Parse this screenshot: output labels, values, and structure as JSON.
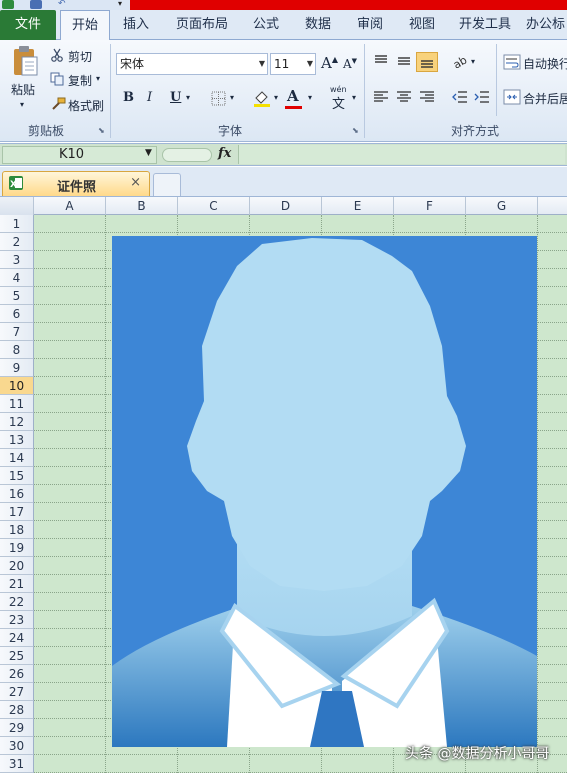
{
  "tabs": {
    "file": "文件",
    "home": "开始",
    "insert": "插入",
    "page_layout": "页面布局",
    "formulas": "公式",
    "data": "数据",
    "review": "审阅",
    "view": "视图",
    "developer": "开发工具",
    "office": "办公标"
  },
  "clipboard": {
    "paste": "粘贴",
    "cut": "剪切",
    "copy": "复制",
    "format_painter": "格式刷",
    "group_label": "剪贴板"
  },
  "font": {
    "name": "宋体",
    "size": "11",
    "bold": "B",
    "italic": "I",
    "underline": "U",
    "font_color_glyph": "A",
    "grow": "A",
    "shrink": "A",
    "phonetic": "wén",
    "phonetic_char": "文",
    "group_label": "字体"
  },
  "alignment": {
    "wrap_text": "自动换行",
    "merge_center": "合并后居",
    "group_label": "对齐方式"
  },
  "formula_bar": {
    "cell_ref": "K10",
    "fx": "fx"
  },
  "document": {
    "tab_title": "证件照",
    "close": "×"
  },
  "grid": {
    "columns": [
      "A",
      "B",
      "C",
      "D",
      "E",
      "F",
      "G"
    ],
    "rows": [
      "1",
      "2",
      "3",
      "4",
      "5",
      "6",
      "7",
      "8",
      "9",
      "10",
      "11",
      "12",
      "13",
      "14",
      "15",
      "16",
      "17",
      "18",
      "19",
      "20",
      "21",
      "22",
      "23",
      "24",
      "25",
      "26",
      "27",
      "28",
      "29",
      "30",
      "31"
    ],
    "selected_row": "10"
  },
  "colors": {
    "sheet_bg": "#cee7cd",
    "photo_bg": "#3d86d6",
    "silhouette": "#b2dcf3",
    "ribbon": "#dfe9f5",
    "file_tab": "#2a7a36"
  },
  "icons": [
    "paste-icon",
    "scissors-icon",
    "copy-icon",
    "format-painter-icon",
    "fx-icon",
    "excel-doc-icon"
  ],
  "watermark": "头条 @数据分析小哥哥"
}
